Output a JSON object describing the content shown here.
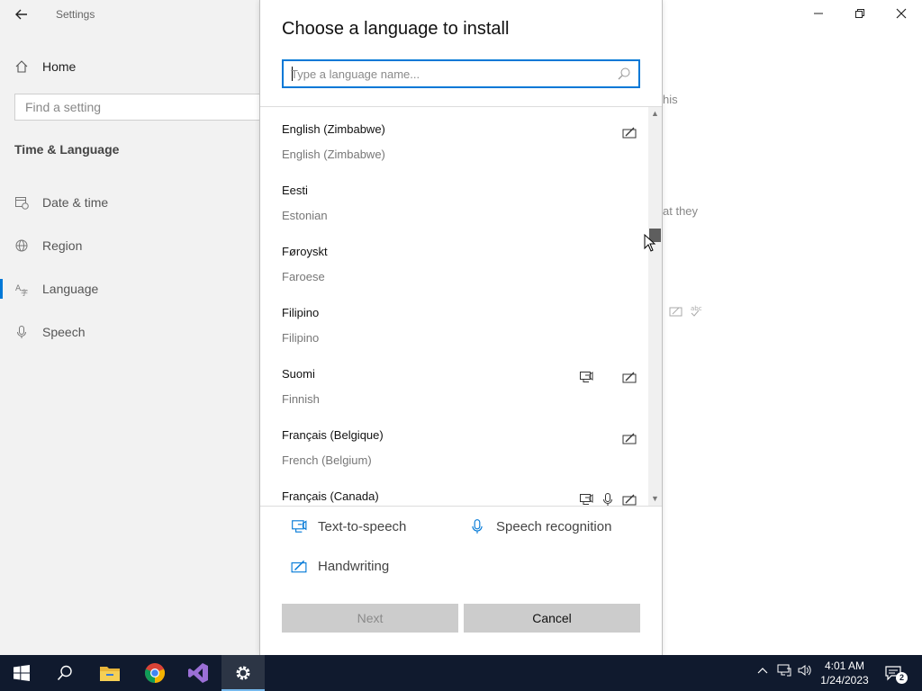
{
  "settings": {
    "app_title": "Settings",
    "nav_home": "Home",
    "find_placeholder": "Find a setting",
    "section_title": "Time & Language",
    "nav_items": [
      {
        "label": "Date & time",
        "icon": "calendar-clock-icon"
      },
      {
        "label": "Region",
        "icon": "globe-icon"
      },
      {
        "label": "Language",
        "icon": "language-icon"
      },
      {
        "label": "Speech",
        "icon": "microphone-icon"
      }
    ],
    "selected_nav": "Language",
    "bg_fragments": [
      "his",
      "at they"
    ]
  },
  "dialog": {
    "title": "Choose a language to install",
    "search_placeholder": "Type a language name...",
    "search_value": "",
    "languages": [
      {
        "native": "English (Zimbabwe)",
        "english": "English (Zimbabwe)",
        "features": [
          "handwriting"
        ]
      },
      {
        "native": "Eesti",
        "english": "Estonian",
        "features": []
      },
      {
        "native": "Føroyskt",
        "english": "Faroese",
        "features": []
      },
      {
        "native": "Filipino",
        "english": "Filipino",
        "features": []
      },
      {
        "native": "Suomi",
        "english": "Finnish",
        "features": [
          "text-to-speech",
          "handwriting"
        ]
      },
      {
        "native": "Français (Belgique)",
        "english": "French (Belgium)",
        "features": [
          "handwriting"
        ]
      },
      {
        "native": "Français (Canada)",
        "english": "",
        "features": [
          "text-to-speech",
          "speech-recognition",
          "handwriting"
        ]
      }
    ],
    "legend": {
      "tts": "Text-to-speech",
      "speech": "Speech recognition",
      "handwriting": "Handwriting"
    },
    "buttons": {
      "next": "Next",
      "cancel": "Cancel"
    },
    "scroll_position_fraction": 0.33
  },
  "taskbar": {
    "apps": [
      "start-icon",
      "search-icon",
      "file-explorer-icon",
      "chrome-icon",
      "visual-studio-icon",
      "settings-gear-icon"
    ],
    "time": "4:01 AM",
    "date": "1/24/2023",
    "notification_count": "2"
  },
  "colors": {
    "accent": "#0078d7",
    "taskbar": "#101a2e",
    "nav_bg": "#f2f2f2",
    "button_bg": "#cccccc"
  }
}
